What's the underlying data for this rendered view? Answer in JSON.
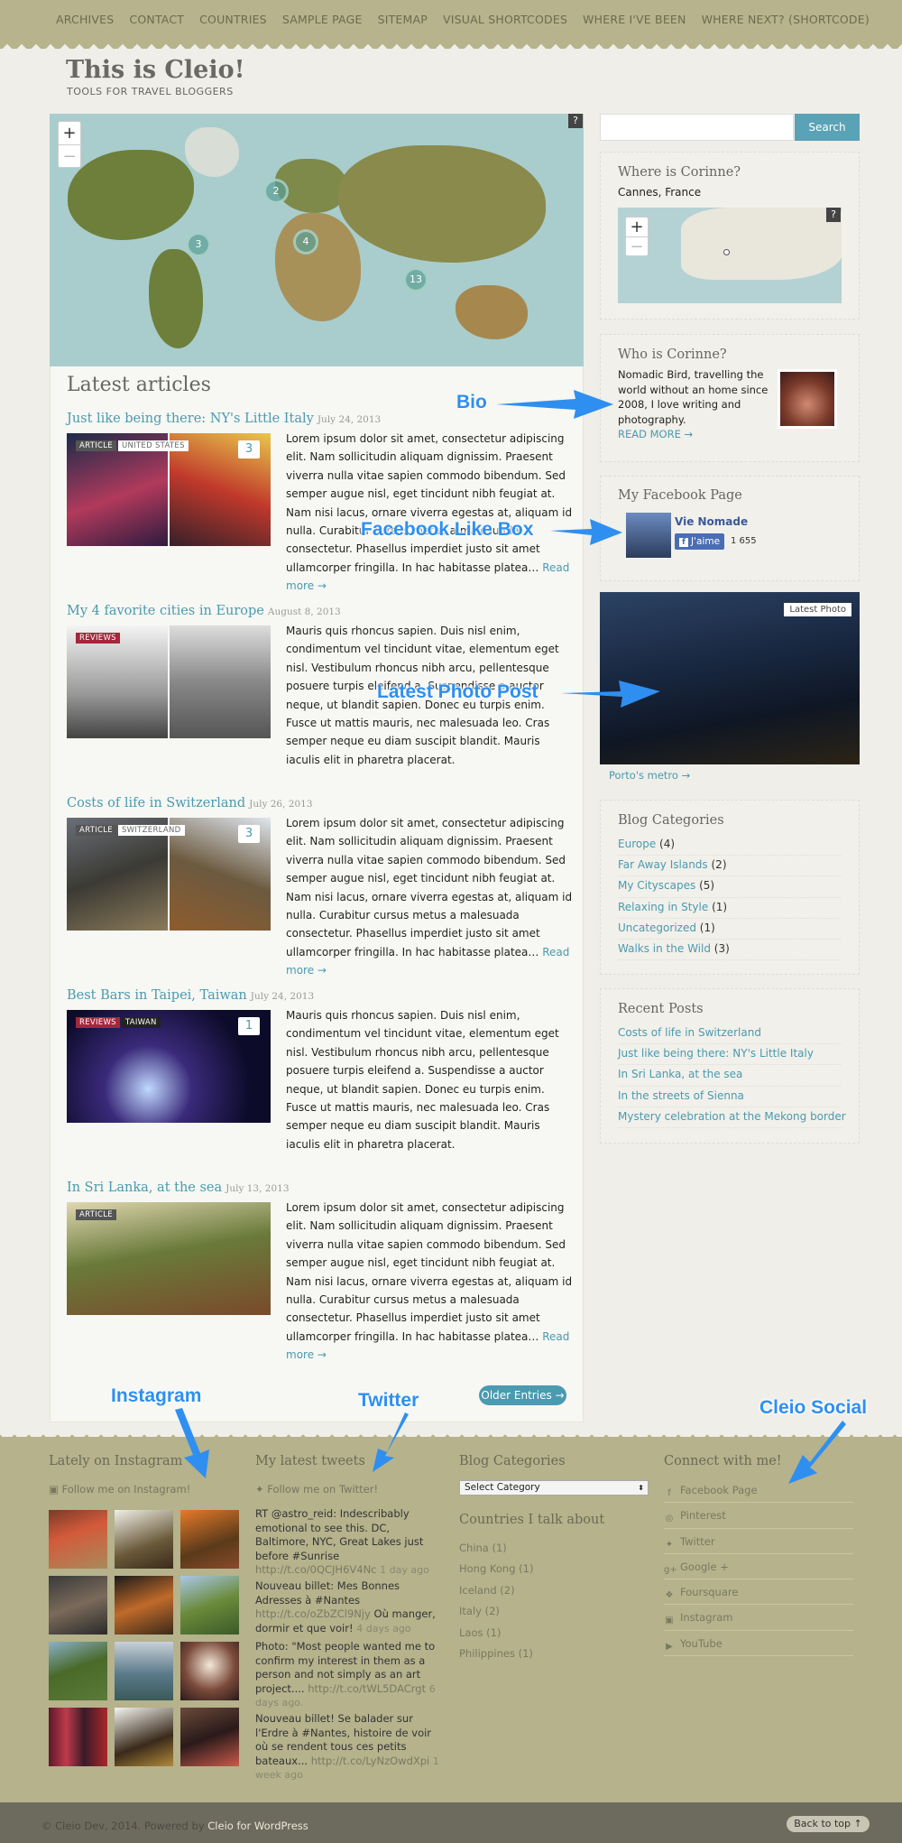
{
  "nav": [
    "ARCHIVES",
    "CONTACT",
    "COUNTRIES",
    "SAMPLE PAGE",
    "SITEMAP",
    "VISUAL SHORTCODES",
    "WHERE I'VE BEEN",
    "WHERE NEXT? (SHORTCODE)"
  ],
  "site": {
    "title": "This is Cleio!",
    "tagline": "TOOLS FOR TRAVEL BLOGGERS"
  },
  "map": {
    "zoom_in": "+",
    "zoom_out": "−",
    "help": "?",
    "clusters": [
      "2",
      "3",
      "4",
      "13"
    ]
  },
  "latest_title": "Latest articles",
  "posts": [
    {
      "title": "Just like being there: NY's Little Italy",
      "date": "July 24, 2013",
      "tags": [
        "ARTICLE",
        "UNITED STATES"
      ],
      "count": "3",
      "text": "Lorem ipsum dolor sit amet, consectetur adipiscing elit. Nam sollicitudin aliquam dignissim. Praesent viverra nulla vitae sapien commodo bibendum. Sed semper augue nisl, eget tincidunt nibh feugiat at. Nam nisi lacus, ornare viverra egestas at, aliquam id nulla. Curabitur cursus metus a malesuada consectetur. Phasellus imperdiet justo sit amet ullamcorper fringilla. In hac habitasse platea…",
      "more": "Read more →"
    },
    {
      "title": "My 4 favorite cities in Europe",
      "date": "August 8, 2013",
      "tags": [
        "REVIEWS"
      ],
      "count": "",
      "text": "Mauris quis rhoncus sapien. Duis nisl enim, condimentum vel tincidunt vitae, elementum eget nisl. Vestibulum rhoncus nibh arcu, pellentesque posuere turpis eleifend a. Suspendisse a auctor neque, ut blandit sapien. Donec eu turpis enim. Fusce ut mattis mauris, nec malesuada leo. Cras semper neque eu diam suscipit blandit. Mauris iaculis elit in pharetra placerat.",
      "more": ""
    },
    {
      "title": "Costs of life in Switzerland",
      "date": "July 26, 2013",
      "tags": [
        "ARTICLE",
        "SWITZERLAND"
      ],
      "count": "3",
      "text": "Lorem ipsum dolor sit amet, consectetur adipiscing elit. Nam sollicitudin aliquam dignissim. Praesent viverra nulla vitae sapien commodo bibendum. Sed semper augue nisl, eget tincidunt nibh feugiat at. Nam nisi lacus, ornare viverra egestas at, aliquam id nulla. Curabitur cursus metus a malesuada consectetur. Phasellus imperdiet justo sit amet ullamcorper fringilla. In hac habitasse platea…",
      "more": "Read more →"
    },
    {
      "title": "Best Bars in Taipei, Taiwan",
      "date": "July 24, 2013",
      "tags": [
        "REVIEWS",
        "TAIWAN"
      ],
      "count": "1",
      "text": "Mauris quis rhoncus sapien. Duis nisl enim, condimentum vel tincidunt vitae, elementum eget nisl. Vestibulum rhoncus nibh arcu, pellentesque posuere turpis eleifend a. Suspendisse a auctor neque, ut blandit sapien. Donec eu turpis enim. Fusce ut mattis mauris, nec malesuada leo. Cras semper neque eu diam suscipit blandit. Mauris iaculis elit in pharetra placerat.",
      "more": ""
    },
    {
      "title": "In Sri Lanka, at the sea",
      "date": "July 13, 2013",
      "tags": [
        "ARTICLE"
      ],
      "count": "",
      "text": "Lorem ipsum dolor sit amet, consectetur adipiscing elit. Nam sollicitudin aliquam dignissim. Praesent viverra nulla vitae sapien commodo bibendum. Sed semper augue nisl, eget tincidunt nibh feugiat at. Nam nisi lacus, ornare viverra egestas at, aliquam id nulla. Curabitur cursus metus a malesuada consectetur. Phasellus imperdiet justo sit amet ullamcorper fringilla. In hac habitasse platea…",
      "more": "Read more →"
    }
  ],
  "older_entries": "Older Entries →",
  "search": {
    "button": "Search",
    "placeholder": ""
  },
  "where": {
    "title": "Where is Corinne?",
    "location": "Cannes, France"
  },
  "who": {
    "title": "Who is Corinne?",
    "bio": "Nomadic Bird, travelling the world without an home since 2008, I love writing and photography.",
    "more": "READ MORE →"
  },
  "facebook": {
    "title": "My Facebook Page",
    "page_name": "Vie Nomade",
    "like": "J'aime",
    "count": "1 655"
  },
  "latest_photo": {
    "badge": "Latest Photo",
    "caption": "Porto's metro →"
  },
  "categories": {
    "title": "Blog Categories",
    "items": [
      {
        "name": "Europe",
        "count": "(4)"
      },
      {
        "name": "Far Away Islands",
        "count": "(2)"
      },
      {
        "name": "My Cityscapes",
        "count": "(5)"
      },
      {
        "name": "Relaxing in Style",
        "count": "(1)"
      },
      {
        "name": "Uncategorized",
        "count": "(1)"
      },
      {
        "name": "Walks in the Wild",
        "count": "(3)"
      }
    ]
  },
  "recent": {
    "title": "Recent Posts",
    "items": [
      "Costs of life in Switzerland",
      "Just like being there: NY's Little Italy",
      "In Sri Lanka, at the sea",
      "In the streets of Sienna",
      "Mystery celebration at the Mekong border"
    ]
  },
  "footer": {
    "instagram": {
      "title": "Lately on Instagram",
      "follow": "Follow me on Instagram!"
    },
    "twitter": {
      "title": "My latest tweets",
      "follow": "Follow me on Twitter!",
      "tweets": [
        {
          "text": "RT @astro_reid: Indescribably emotional to see this. DC, Baltimore, NYC, Great Lakes just before #Sunrise",
          "link": "http://t.co/0QCJH6V4Nc",
          "time": "1 day ago"
        },
        {
          "text": "Nouveau billet: Mes Bonnes Adresses à #Nantes",
          "link": "http://t.co/oZbZCl9Njy",
          "extra": "Où manger, dormir et que voir!",
          "time": "4 days ago"
        },
        {
          "text": "Photo: \"Most people wanted me to confirm my interest in them as a person and not simply as an art project....",
          "link": "http://t.co/tWL5DACrgt",
          "time": "6 days ago."
        },
        {
          "text": "Nouveau billet! Se balader sur l'Erdre à #Nantes, histoire de voir où se rendent tous ces petits bateaux...",
          "link": "http://t.co/LyNzOwdXpi",
          "time": "1 week ago"
        }
      ]
    },
    "blog_categories": {
      "title": "Blog Categories",
      "select": "Select Category"
    },
    "countries": {
      "title": "Countries I talk about",
      "items": [
        "China (1)",
        "Hong Kong (1)",
        "Iceland (2)",
        "Italy (2)",
        "Laos (1)",
        "Philippines (1)"
      ]
    },
    "connect": {
      "title": "Connect with me!",
      "items": [
        {
          "label": "Facebook Page",
          "icon": "f"
        },
        {
          "label": "Pinterest",
          "icon": "◎"
        },
        {
          "label": "Twitter",
          "icon": "✦"
        },
        {
          "label": "Google +",
          "icon": "g+"
        },
        {
          "label": "Foursquare",
          "icon": "❖"
        },
        {
          "label": "Instagram",
          "icon": "▣"
        },
        {
          "label": "YouTube",
          "icon": "▶"
        }
      ]
    },
    "copyright": "© Cleio Dev, 2014. Powered by",
    "copyright_link": "Cleio for WordPress",
    "back_to_top": "Back to top ↑"
  },
  "annotations": {
    "bio": "Bio",
    "facebook": "Facebook Like Box",
    "photo": "Latest Photo Post",
    "instagram": "Instagram",
    "twitter": "Twitter",
    "social": "Cleio Social"
  },
  "colors": {
    "accent": "#4a9ab0",
    "nav_bg": "#b7b38c",
    "footer_bg": "#b5b28c",
    "annotation": "#2e8ff0"
  }
}
